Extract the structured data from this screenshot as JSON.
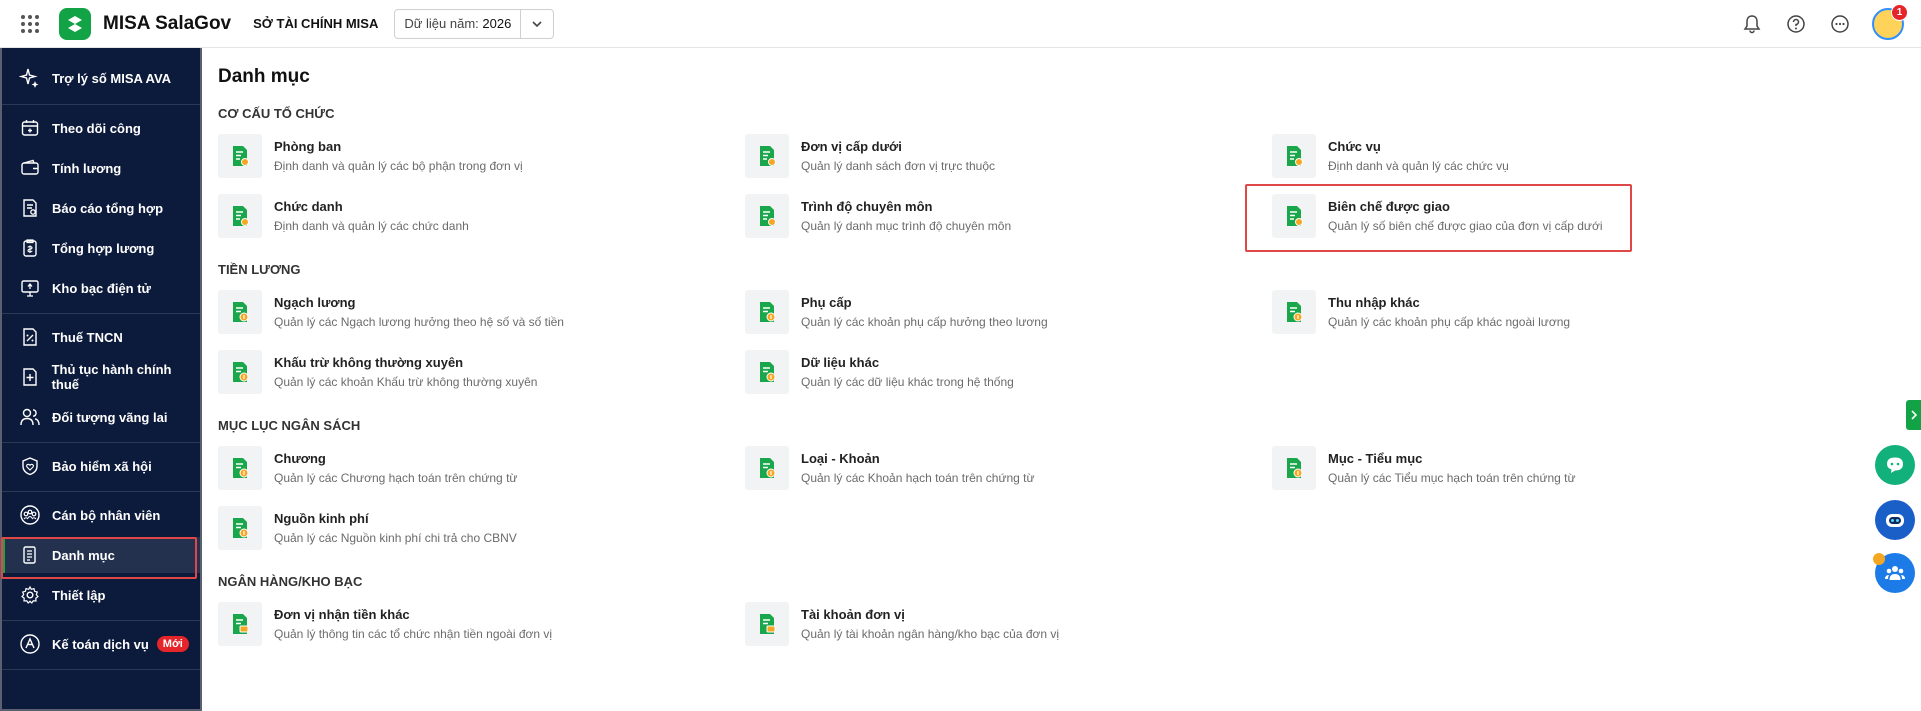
{
  "topbar": {
    "brand": "MISA SalaGov",
    "org": "SỞ TÀI CHÍNH MISA",
    "year_label": "Dữ liệu năm: ",
    "year_value": "2026",
    "notification_count": "1"
  },
  "sidebar": {
    "items": [
      {
        "label": "Trợ lý số MISA AVA",
        "icon": "sparkle-icon"
      },
      {
        "label": "Theo dõi công",
        "icon": "calendar-icon"
      },
      {
        "label": "Tính lương",
        "icon": "wallet-icon"
      },
      {
        "label": "Báo cáo tổng hợp",
        "icon": "report-icon"
      },
      {
        "label": "Tổng hợp lương",
        "icon": "payroll-icon"
      },
      {
        "label": "Kho bạc điện tử",
        "icon": "monitor-icon"
      },
      {
        "label": "Thuế TNCN",
        "icon": "tax-icon"
      },
      {
        "label": "Thủ tục hành chính thuế",
        "icon": "document-add-icon"
      },
      {
        "label": "Đối tượng vãng lai",
        "icon": "users-icon"
      },
      {
        "label": "Bảo hiểm xã hội",
        "icon": "shield-heart-icon"
      },
      {
        "label": "Cán bộ nhân viên",
        "icon": "staff-icon"
      },
      {
        "label": "Danh mục",
        "icon": "list-doc-icon"
      },
      {
        "label": "Thiết lập",
        "icon": "gear-icon"
      },
      {
        "label": "Kế toán dịch vụ",
        "icon": "accounting-icon",
        "badge": "Mới"
      }
    ],
    "active": "Danh mục"
  },
  "main": {
    "title": "Danh mục",
    "sections": [
      {
        "title": "CƠ CẤU TỔ CHỨC",
        "items": [
          {
            "name": "Phòng ban",
            "desc": "Định danh và quản lý các bộ phận trong đơn vị"
          },
          {
            "name": "Đơn vị cấp dưới",
            "desc": "Quản lý danh sách đơn vị trực thuộc"
          },
          {
            "name": "Chức vụ",
            "desc": "Định danh và quản lý các chức vụ"
          },
          {
            "name": "Chức danh",
            "desc": "Định danh và quản lý các chức danh"
          },
          {
            "name": "Trình độ chuyên môn",
            "desc": "Quản lý danh mục trình độ chuyên môn"
          },
          {
            "name": "Biên chế được giao",
            "desc": "Quản lý số biên chế được giao của đơn vị cấp dưới"
          }
        ]
      },
      {
        "title": "TIỀN LƯƠNG",
        "items": [
          {
            "name": "Ngạch lương",
            "desc": "Quản lý các Ngạch lương hưởng theo hệ số và số tiền"
          },
          {
            "name": "Phụ cấp",
            "desc": "Quản lý các khoản phụ cấp hưởng theo lương"
          },
          {
            "name": "Thu nhập khác",
            "desc": "Quản lý các khoản phụ cấp khác ngoài lương"
          },
          {
            "name": "Khấu trừ không thường xuyên",
            "desc": "Quản lý các khoản Khấu trừ không thường xuyên"
          },
          {
            "name": "Dữ liệu khác",
            "desc": "Quản lý các dữ liệu khác trong hệ thống"
          }
        ]
      },
      {
        "title": "MỤC LỤC NGÂN SÁCH",
        "items": [
          {
            "name": "Chương",
            "desc": "Quản lý các Chương hạch toán trên chứng từ"
          },
          {
            "name": "Loại - Khoản",
            "desc": "Quản lý các Khoản hạch toán trên chứng từ"
          },
          {
            "name": "Mục - Tiểu mục",
            "desc": "Quản lý các Tiểu mục hạch toán trên chứng từ"
          },
          {
            "name": "Nguồn kinh phí",
            "desc": "Quản lý các Nguồn kinh phí chi trả cho CBNV"
          }
        ]
      },
      {
        "title": "NGÂN HÀNG/KHO BẠC",
        "items": [
          {
            "name": "Đơn vị nhận tiền khác",
            "desc": "Quản lý thông tin các tổ chức nhận tiền ngoài đơn vị"
          },
          {
            "name": "Tài khoản đơn vị",
            "desc": "Quản lý tài khoản ngân hàng/kho bạc của đơn vị"
          }
        ]
      }
    ]
  },
  "colors": {
    "brand_green": "#11a345",
    "sidebar_bg": "#0c1a3b",
    "highlight_red": "#e04848"
  }
}
